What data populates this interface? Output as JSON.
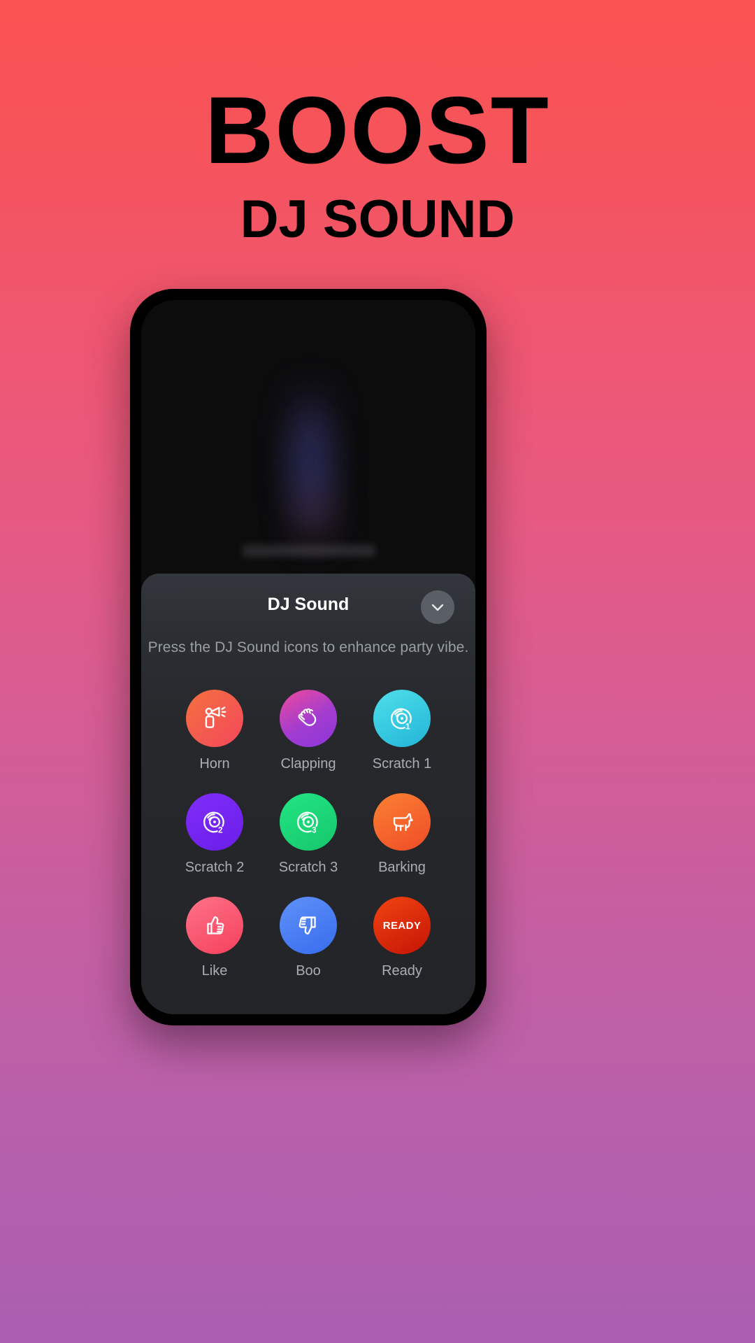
{
  "promo": {
    "title": "BOOST",
    "subtitle": "DJ SOUND",
    "bg_top_color": "#fb5252",
    "bg_bottom_color": "#ab5fb0"
  },
  "sheet": {
    "title": "DJ Sound",
    "description": "Press the DJ Sound icons to enhance party vibe.",
    "close_icon": "chevron-down-icon",
    "background_color": "#2a2d32"
  },
  "sounds": [
    {
      "label": "Horn",
      "icon": "horn-icon",
      "color_from": "#f4703f",
      "color_to": "#f44b58"
    },
    {
      "label": "Clapping",
      "icon": "clapping-hands-icon",
      "color_from": "#e8459c",
      "color_to": "#9b3bd4"
    },
    {
      "label": "Scratch 1",
      "icon": "vinyl-record-1-icon",
      "color_from": "#49dbe8",
      "color_to": "#1fb6d8",
      "badge": "1"
    },
    {
      "label": "Scratch 2",
      "icon": "vinyl-record-2-icon",
      "color_from": "#7b2bf5",
      "color_to": "#6a20e8",
      "badge": "2"
    },
    {
      "label": "Scratch 3",
      "icon": "vinyl-record-3-icon",
      "color_from": "#1fe07e",
      "color_to": "#17c96e",
      "badge": "3"
    },
    {
      "label": "Barking",
      "icon": "dog-icon",
      "color_from": "#f97b30",
      "color_to": "#f0512a"
    },
    {
      "label": "Like",
      "icon": "thumbs-up-icon",
      "color_from": "#fb6f84",
      "color_to": "#f6415c"
    },
    {
      "label": "Boo",
      "icon": "thumbs-down-icon",
      "color_from": "#5b8cf7",
      "color_to": "#3a6ff0"
    },
    {
      "label": "Ready",
      "icon": "ready-badge-icon",
      "color_from": "#ef3a11",
      "color_to": "#c91505",
      "text": "READY"
    }
  ]
}
